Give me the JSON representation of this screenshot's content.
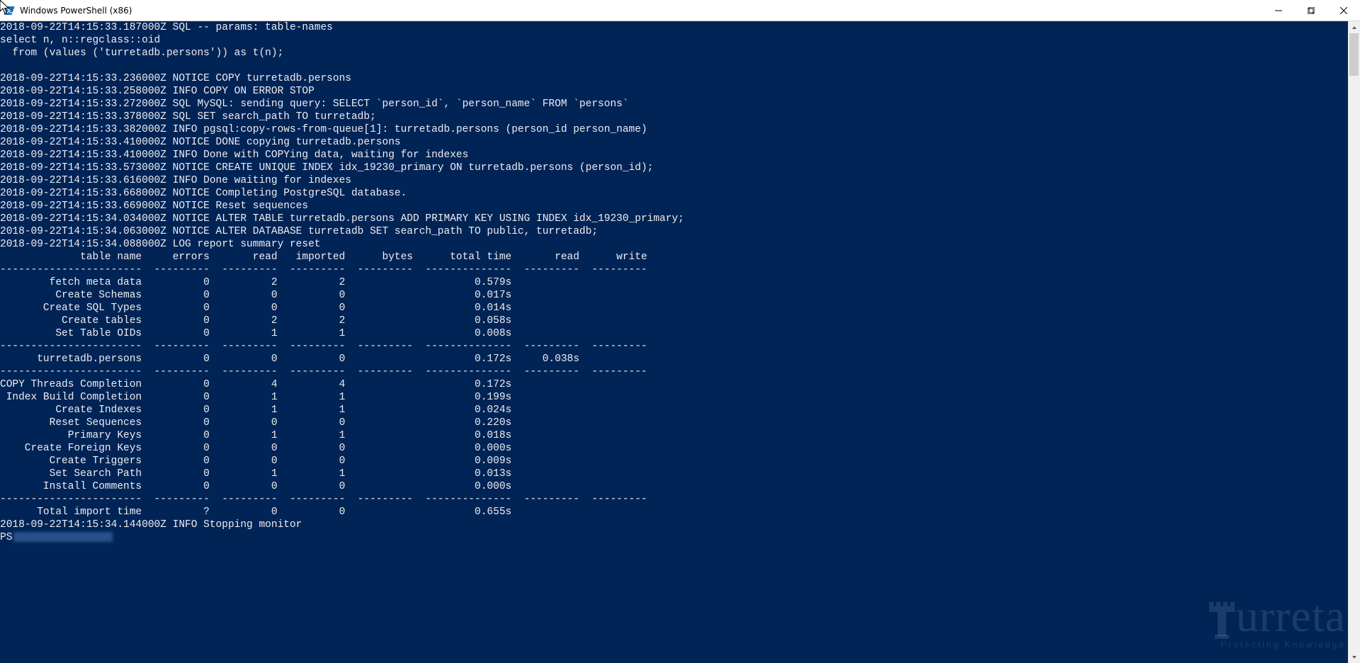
{
  "window": {
    "title": "Windows PowerShell (x86)"
  },
  "watermark": {
    "brand": "urreta",
    "tagline": "Protecting Knowledge"
  },
  "log_lines": [
    "2018-09-22T14:15:33.187000Z SQL -- params: table-names",
    "select n, n::regclass::oid",
    "  from (values ('turretadb.persons')) as t(n);",
    "",
    "2018-09-22T14:15:33.236000Z NOTICE COPY turretadb.persons",
    "2018-09-22T14:15:33.258000Z INFO COPY ON ERROR STOP",
    "2018-09-22T14:15:33.272000Z SQL MySQL: sending query: SELECT `person_id`, `person_name` FROM `persons`",
    "2018-09-22T14:15:33.378000Z SQL SET search_path TO turretadb;",
    "2018-09-22T14:15:33.382000Z INFO pgsql:copy-rows-from-queue[1]: turretadb.persons (person_id person_name)",
    "2018-09-22T14:15:33.410000Z NOTICE DONE copying turretadb.persons",
    "2018-09-22T14:15:33.410000Z INFO Done with COPYing data, waiting for indexes",
    "2018-09-22T14:15:33.573000Z NOTICE CREATE UNIQUE INDEX idx_19230_primary ON turretadb.persons (person_id);",
    "2018-09-22T14:15:33.616000Z INFO Done waiting for indexes",
    "2018-09-22T14:15:33.668000Z NOTICE Completing PostgreSQL database.",
    "2018-09-22T14:15:33.669000Z NOTICE Reset sequences",
    "2018-09-22T14:15:34.034000Z NOTICE ALTER TABLE turretadb.persons ADD PRIMARY KEY USING INDEX idx_19230_primary;",
    "2018-09-22T14:15:34.063000Z NOTICE ALTER DATABASE turretadb SET search_path TO public, turretadb;",
    "2018-09-22T14:15:34.088000Z LOG report summary reset"
  ],
  "table_header": {
    "c0": "table name",
    "c1": "errors",
    "c2": "read",
    "c3": "imported",
    "c4": "bytes",
    "c5": "total time",
    "c6": "read",
    "c7": "write"
  },
  "table_sep": "-----------------------  ---------  ---------  ---------  ---------  --------------  ---------  ---------",
  "table_rows_1": [
    {
      "name": "fetch meta data",
      "errors": "0",
      "read": "2",
      "imported": "2",
      "bytes": "",
      "total": "0.579s",
      "r": "",
      "w": ""
    },
    {
      "name": "Create Schemas",
      "errors": "0",
      "read": "0",
      "imported": "0",
      "bytes": "",
      "total": "0.017s",
      "r": "",
      "w": ""
    },
    {
      "name": "Create SQL Types",
      "errors": "0",
      "read": "0",
      "imported": "0",
      "bytes": "",
      "total": "0.014s",
      "r": "",
      "w": ""
    },
    {
      "name": "Create tables",
      "errors": "0",
      "read": "2",
      "imported": "2",
      "bytes": "",
      "total": "0.058s",
      "r": "",
      "w": ""
    },
    {
      "name": "Set Table OIDs",
      "errors": "0",
      "read": "1",
      "imported": "1",
      "bytes": "",
      "total": "0.008s",
      "r": "",
      "w": ""
    }
  ],
  "table_rows_2": [
    {
      "name": "turretadb.persons",
      "errors": "0",
      "read": "0",
      "imported": "0",
      "bytes": "",
      "total": "0.172s",
      "r": "0.038s",
      "w": ""
    }
  ],
  "table_rows_3": [
    {
      "name": "COPY Threads Completion",
      "errors": "0",
      "read": "4",
      "imported": "4",
      "bytes": "",
      "total": "0.172s",
      "r": "",
      "w": ""
    },
    {
      "name": "Index Build Completion",
      "errors": "0",
      "read": "1",
      "imported": "1",
      "bytes": "",
      "total": "0.199s",
      "r": "",
      "w": ""
    },
    {
      "name": "Create Indexes",
      "errors": "0",
      "read": "1",
      "imported": "1",
      "bytes": "",
      "total": "0.024s",
      "r": "",
      "w": ""
    },
    {
      "name": "Reset Sequences",
      "errors": "0",
      "read": "0",
      "imported": "0",
      "bytes": "",
      "total": "0.220s",
      "r": "",
      "w": ""
    },
    {
      "name": "Primary Keys",
      "errors": "0",
      "read": "1",
      "imported": "1",
      "bytes": "",
      "total": "0.018s",
      "r": "",
      "w": ""
    },
    {
      "name": "Create Foreign Keys",
      "errors": "0",
      "read": "0",
      "imported": "0",
      "bytes": "",
      "total": "0.000s",
      "r": "",
      "w": ""
    },
    {
      "name": "Create Triggers",
      "errors": "0",
      "read": "0",
      "imported": "0",
      "bytes": "",
      "total": "0.009s",
      "r": "",
      "w": ""
    },
    {
      "name": "Set Search Path",
      "errors": "0",
      "read": "1",
      "imported": "1",
      "bytes": "",
      "total": "0.013s",
      "r": "",
      "w": ""
    },
    {
      "name": "Install Comments",
      "errors": "0",
      "read": "0",
      "imported": "0",
      "bytes": "",
      "total": "0.000s",
      "r": "",
      "w": ""
    }
  ],
  "total_row": {
    "name": "Total import time",
    "errors": "?",
    "read": "0",
    "imported": "0",
    "bytes": "",
    "total": "0.655s",
    "r": "",
    "w": ""
  },
  "post_lines": [
    "2018-09-22T14:15:34.144000Z INFO Stopping monitor"
  ],
  "prompt": "PS"
}
